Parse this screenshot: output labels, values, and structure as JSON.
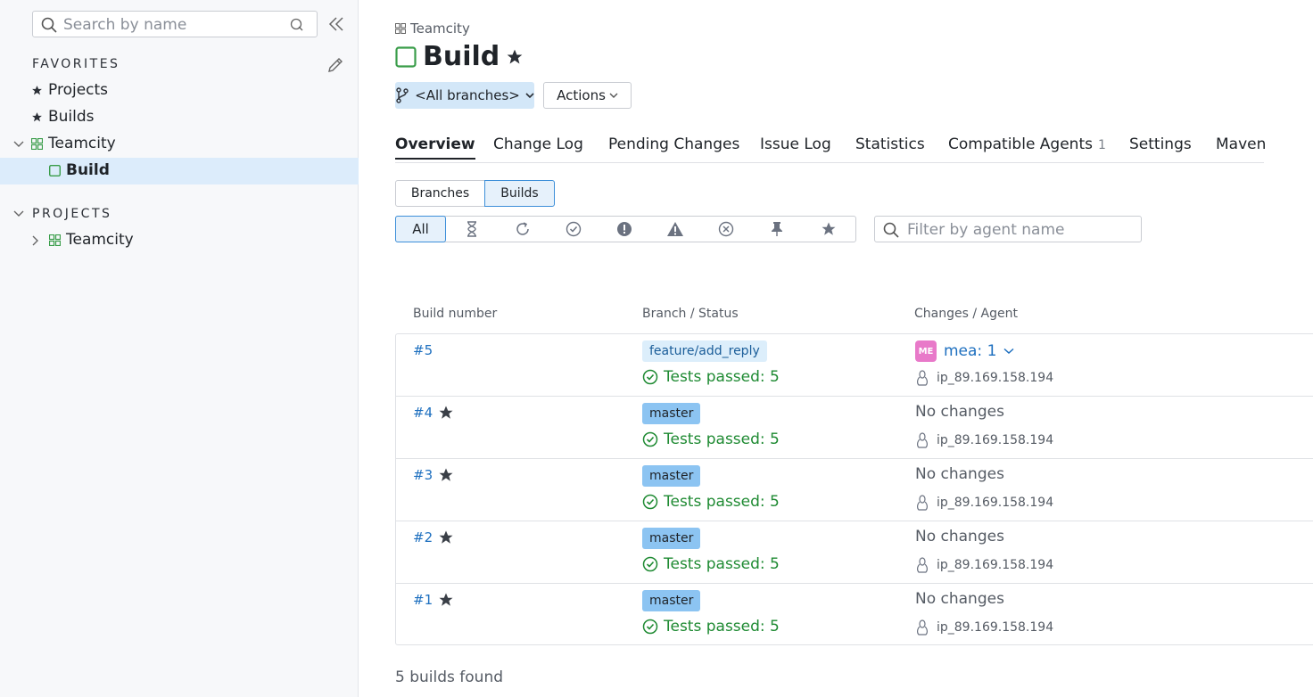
{
  "sidebar": {
    "search_placeholder": "Search by name",
    "favorites_title": "FAVORITES",
    "favorites": [
      {
        "label": "Projects"
      },
      {
        "label": "Builds"
      }
    ],
    "tree": {
      "project": "Teamcity",
      "build": "Build"
    },
    "projects_title": "PROJECTS",
    "projects": [
      {
        "label": "Teamcity"
      }
    ]
  },
  "header": {
    "breadcrumb": "Teamcity",
    "title": "Build",
    "branch_selector": "<All branches>",
    "actions_label": "Actions"
  },
  "tabs": [
    {
      "label": "Overview",
      "active": true
    },
    {
      "label": "Change Log"
    },
    {
      "label": "Pending Changes"
    },
    {
      "label": "Issue Log"
    },
    {
      "label": "Statistics"
    },
    {
      "label": "Compatible Agents",
      "count": "1"
    },
    {
      "label": "Settings"
    },
    {
      "label": "Maven"
    }
  ],
  "view_toggle": {
    "branches": "Branches",
    "builds": "Builds",
    "selected": "Builds"
  },
  "status_filters": {
    "all_label": "All",
    "icons": [
      "hourglass-icon",
      "running-icon",
      "success-icon",
      "failed-icon",
      "warning-icon",
      "cancelled-icon",
      "pin-icon",
      "star-icon"
    ]
  },
  "agent_filter_placeholder": "Filter by agent name",
  "table": {
    "headers": [
      "Build number",
      "Branch / Status",
      "Changes / Agent"
    ],
    "rows": [
      {
        "number": "#5",
        "starred": false,
        "branch": "feature/add_reply",
        "status": "Tests passed: 5",
        "changes": "mea: 1",
        "avatar": "ME",
        "agent": "ip_89.169.158.194"
      },
      {
        "number": "#4",
        "starred": true,
        "branch": "master",
        "status": "Tests passed: 5",
        "changes": "No changes",
        "agent": "ip_89.169.158.194"
      },
      {
        "number": "#3",
        "starred": true,
        "branch": "master",
        "status": "Tests passed: 5",
        "changes": "No changes",
        "agent": "ip_89.169.158.194"
      },
      {
        "number": "#2",
        "starred": true,
        "branch": "master",
        "status": "Tests passed: 5",
        "changes": "No changes",
        "agent": "ip_89.169.158.194"
      },
      {
        "number": "#1",
        "starred": true,
        "branch": "master",
        "status": "Tests passed: 5",
        "changes": "No changes",
        "agent": "ip_89.169.158.194"
      }
    ]
  },
  "footer": "5 builds found",
  "colors": {
    "link": "#1d6fbf",
    "success": "#1e8a32",
    "selected_bg": "#dcecfb",
    "branch_default_bg": "#8cc4f2",
    "branch_feature_bg": "#dceefb",
    "avatar_bg": "#e879c9"
  }
}
